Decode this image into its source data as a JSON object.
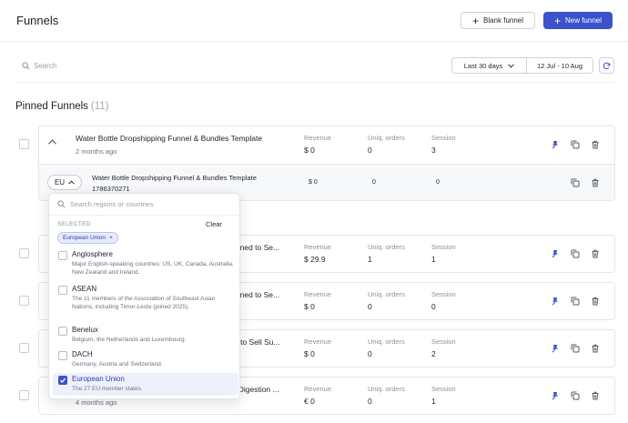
{
  "header": {
    "title": "Funnels",
    "blank_label": "Blank funnel",
    "new_label": "New funnel"
  },
  "filters": {
    "search_placeholder": "Search",
    "date_preset": "Last 30 days",
    "date_range": "12 Jul - 10 Aug"
  },
  "pinned": {
    "title": "Pinned Funnels",
    "count": "(11)"
  },
  "metric_labels": {
    "revenue": "Revenue",
    "orders": "Uniq. orders",
    "session": "Session"
  },
  "funnels": [
    {
      "name": "Water Bottle Dropshipping Funnel & Bundles Template",
      "age": "2 months ago",
      "revenue": "$ 0",
      "orders": "0",
      "session": "3"
    },
    {
      "name": "igned to Se...",
      "age": "",
      "revenue": "$ 29.9",
      "orders": "1",
      "session": "1"
    },
    {
      "name": "igned to Se...",
      "age": "",
      "revenue": "$ 0",
      "orders": "0",
      "session": "0"
    },
    {
      "name": "d to Sell Su...",
      "age": "",
      "revenue": "$ 0",
      "orders": "0",
      "session": "2"
    },
    {
      "name": ", Digestion ...",
      "age": "4 months ago",
      "revenue": "€ 0",
      "orders": "0",
      "session": "1"
    }
  ],
  "expanded": {
    "region_code": "EU",
    "name": "Water Bottle Dropshipping Funnel & Bundles Template",
    "id": "1786370271",
    "revenue": "$ 0",
    "orders": "0",
    "session": "0"
  },
  "region_dropdown": {
    "search_placeholder": "Search regions or countries",
    "selected_label": "SELECTED",
    "clear_label": "Clear",
    "chip": "European Union",
    "chip_close": "×",
    "options": [
      {
        "title": "Anglosphere",
        "desc": "Major English-speaking countries: US, UK, Canada, Australia, New Zealand and Ireland.",
        "checked": false
      },
      {
        "title": "ASEAN",
        "desc": "The 11 members of the Association of Southeast Asian Nations, including Timor-Leste (joined 2025).",
        "checked": false
      },
      {
        "title": "Benelux",
        "desc": "Belgium, the Netherlands and Luxembourg.",
        "checked": false
      },
      {
        "title": "DACH",
        "desc": "Germany, Austria and Switzerland.",
        "checked": false
      },
      {
        "title": "European Union",
        "desc": "The 27 EU member states.",
        "checked": true
      }
    ]
  },
  "colors": {
    "accent": "#3b52cc",
    "pin": "#3b52cc",
    "border": "#e4e6ec"
  }
}
